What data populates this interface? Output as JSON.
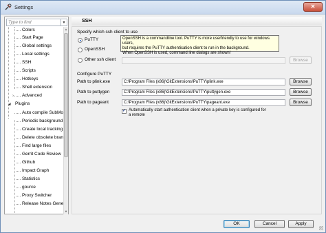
{
  "window": {
    "title": "Settings",
    "close_label": "✕"
  },
  "tree": {
    "filter_placeholder": "Type to find",
    "items": [
      {
        "label": "Colors"
      },
      {
        "label": "Start Page"
      },
      {
        "label": "Global settings"
      },
      {
        "label": "Local settings"
      },
      {
        "label": "SSH"
      },
      {
        "label": "Scripts"
      },
      {
        "label": "Hotkeys"
      },
      {
        "label": "Shell extension"
      },
      {
        "label": "Advanced"
      },
      {
        "label": "Plugins"
      },
      {
        "label": "Auto compile SubModu"
      },
      {
        "label": "Periodic background fe"
      },
      {
        "label": "Create local tracking br"
      },
      {
        "label": "Delete obsolete branche"
      },
      {
        "label": "Find large files"
      },
      {
        "label": "Gerrit Code Review"
      },
      {
        "label": "Github"
      },
      {
        "label": "Impact Graph"
      },
      {
        "label": "Statistics"
      },
      {
        "label": "gource"
      },
      {
        "label": "Proxy Switcher"
      },
      {
        "label": "Release Notes Generato"
      }
    ]
  },
  "ssh": {
    "header": "SSH",
    "client_group_label": "Specify which ssh client to use",
    "options": [
      {
        "label": "PuTTY",
        "checked": true
      },
      {
        "label": "OpenSSH",
        "checked": false
      },
      {
        "label": "Other ssh client",
        "checked": false
      }
    ],
    "other_client_value": "",
    "browse_label": "Browse",
    "tooltip_lines": [
      "OpenSSH is a commandline tool. PuTTY is more userfriendly to use for windows users,",
      "but requires the PuTTY authentication client to run in the background.",
      "When OpenSSH is used, command line dialogs are shown!"
    ]
  },
  "putty": {
    "group_label": "Configure PuTTY",
    "fields": [
      {
        "label": "Path to plink.exe",
        "value": "C:\\Program Files (x86)\\GitExtensions\\PuTTY\\plink.exe"
      },
      {
        "label": "Path to puttygen",
        "value": "C:\\Program Files (x86)\\GitExtensions\\PuTTY\\puttygen.exe"
      },
      {
        "label": "Path to pageant",
        "value": "C:\\Program Files (x86)\\GitExtensions\\PuTTY\\pageant.exe"
      }
    ],
    "auto_start_line1": "Automatically start authentication client when a private key is configured for",
    "auto_start_line2": "a remote",
    "auto_start_checked": true
  },
  "buttons": {
    "ok": "OK",
    "cancel": "Cancel",
    "apply": "Apply"
  }
}
